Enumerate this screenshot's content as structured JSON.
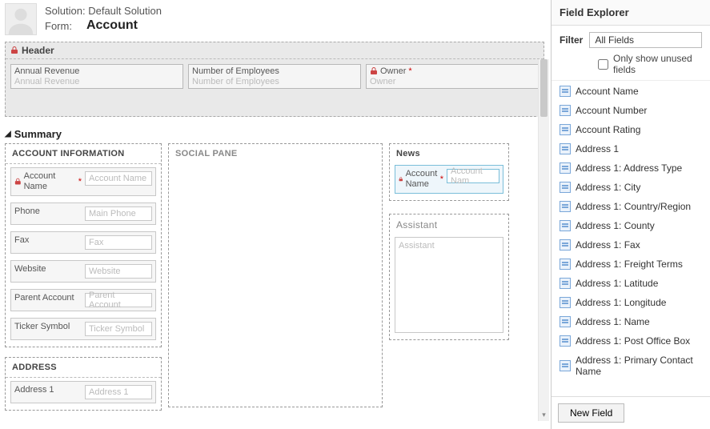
{
  "header": {
    "solution_label": "Solution:",
    "solution_name": "Default Solution",
    "form_label": "Form:",
    "entity_name": "Account"
  },
  "formHeader": {
    "title": "Header",
    "fields": [
      {
        "label": "Annual Revenue",
        "placeholder": "Annual Revenue",
        "locked": false,
        "required": false
      },
      {
        "label": "Number of Employees",
        "placeholder": "Number of Employees",
        "locked": false,
        "required": false
      },
      {
        "label": "Owner",
        "placeholder": "Owner",
        "locked": true,
        "required": true
      }
    ]
  },
  "tab": {
    "title": "Summary"
  },
  "accountInfo": {
    "title": "ACCOUNT INFORMATION",
    "fields": [
      {
        "label": "Account Name",
        "placeholder": "Account Name",
        "locked": true,
        "required": true
      },
      {
        "label": "Phone",
        "placeholder": "Main Phone",
        "locked": false,
        "required": false
      },
      {
        "label": "Fax",
        "placeholder": "Fax",
        "locked": false,
        "required": false
      },
      {
        "label": "Website",
        "placeholder": "Website",
        "locked": false,
        "required": false
      },
      {
        "label": "Parent Account",
        "placeholder": "Parent Account",
        "locked": false,
        "required": false
      },
      {
        "label": "Ticker Symbol",
        "placeholder": "Ticker Symbol",
        "locked": false,
        "required": false
      }
    ]
  },
  "social": {
    "title": "SOCIAL PANE"
  },
  "news": {
    "title": "News",
    "field": {
      "label": "Account Name",
      "placeholder": "Account Nam",
      "locked": true,
      "required": true
    }
  },
  "assistant": {
    "title": "Assistant",
    "placeholder": "Assistant"
  },
  "address": {
    "title": "ADDRESS",
    "field": {
      "label": "Address 1",
      "placeholder": "Address 1"
    }
  },
  "explorer": {
    "title": "Field Explorer",
    "filter_label": "Filter",
    "filter_value": "All Fields",
    "unused_label": "Only show unused fields",
    "items": [
      "Account Name",
      "Account Number",
      "Account Rating",
      "Address 1",
      "Address 1: Address Type",
      "Address 1: City",
      "Address 1: Country/Region",
      "Address 1: County",
      "Address 1: Fax",
      "Address 1: Freight Terms",
      "Address 1: Latitude",
      "Address 1: Longitude",
      "Address 1: Name",
      "Address 1: Post Office Box",
      "Address 1: Primary Contact Name"
    ],
    "new_button": "New Field"
  }
}
